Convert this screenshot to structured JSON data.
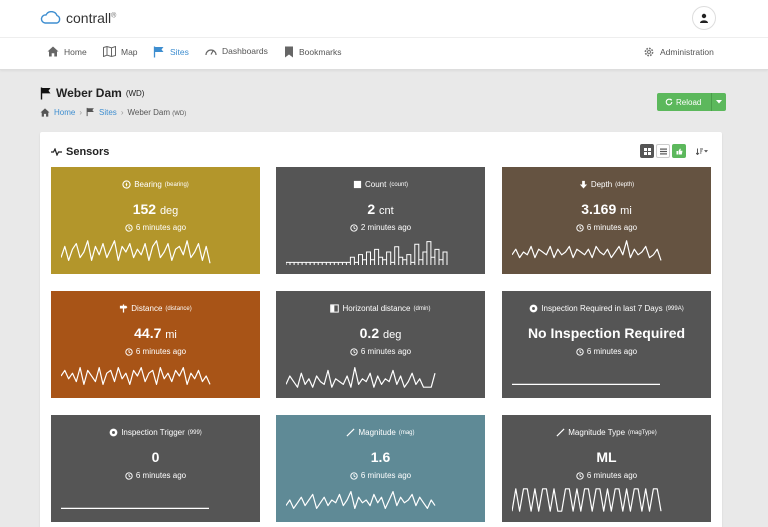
{
  "app": {
    "brand": "contrall",
    "brand_mark": "®"
  },
  "nav": {
    "items": [
      {
        "label": "Home",
        "icon": "home-icon"
      },
      {
        "label": "Map",
        "icon": "map-icon"
      },
      {
        "label": "Sites",
        "icon": "flag-icon",
        "active": true
      },
      {
        "label": "Dashboards",
        "icon": "gauge-icon"
      },
      {
        "label": "Bookmarks",
        "icon": "bookmark-icon"
      }
    ],
    "admin_label": "Administration"
  },
  "page": {
    "title": "Weber Dam",
    "code": "(WD)",
    "breadcrumb": {
      "home": "Home",
      "sites": "Sites",
      "current": "Weber Dam",
      "current_code": "(WD)"
    },
    "reload_label": "Reload"
  },
  "panel": {
    "title": "Sensors"
  },
  "cards": [
    {
      "title": "Bearing",
      "code": "(bearing)",
      "value": "152",
      "unit": "deg",
      "time": "6 minutes ago",
      "color": "#b3962b",
      "icon": "compass-icon",
      "spark": [
        0.3,
        0.7,
        0.2,
        0.6,
        0.8,
        0.3,
        0.5,
        0.9,
        0.2,
        0.7,
        0.4,
        0.8,
        0.3,
        0.6,
        0.9,
        0.2,
        0.7,
        0.5,
        0.8,
        0.3,
        0.6,
        0.4,
        0.8,
        0.2,
        0.7,
        0.9,
        0.3,
        0.5,
        0.8,
        0.2,
        0.6,
        0.7,
        0.4,
        0.9,
        0.3,
        0.5,
        0.8,
        0.2,
        0.7,
        0.1
      ]
    },
    {
      "title": "Count",
      "code": "(count)",
      "value": "2",
      "unit": "cnt",
      "time": "2 minutes ago",
      "color": "#555555",
      "icon": "square-icon",
      "spark": [
        0.1,
        0.1,
        0.1,
        0.1,
        0.1,
        0.1,
        0.1,
        0.1,
        0.1,
        0.1,
        0.1,
        0.1,
        0.1,
        0.1,
        0.1,
        0.1,
        0.3,
        0.1,
        0.4,
        0.2,
        0.5,
        0.2,
        0.6,
        0.3,
        0.2,
        0.5,
        0.1,
        0.7,
        0.3,
        0.2,
        0.4,
        0.1,
        0.8,
        0.2,
        0.5,
        0.9,
        0.3,
        0.6,
        0.2,
        0.5
      ]
    },
    {
      "title": "Depth",
      "code": "(depth)",
      "value": "3.169",
      "unit": "mi",
      "time": "6 minutes ago",
      "color": "#655341",
      "icon": "arrow-down-icon",
      "spark": [
        0.4,
        0.6,
        0.3,
        0.5,
        0.4,
        0.7,
        0.3,
        0.6,
        0.5,
        0.4,
        0.7,
        0.3,
        0.6,
        0.4,
        0.5,
        0.7,
        0.3,
        0.6,
        0.5,
        0.4,
        0.6,
        0.3,
        0.7,
        0.5,
        0.4,
        0.6,
        0.3,
        0.5,
        0.7,
        0.4,
        0.9,
        0.3,
        0.6,
        0.4,
        0.5,
        0.7,
        0.3,
        0.4,
        0.6,
        0.2
      ]
    },
    {
      "title": "Distance",
      "code": "(distance)",
      "value": "44.7",
      "unit": "mi",
      "time": "6 minutes ago",
      "color": "#a85417",
      "icon": "signpost-icon",
      "spark": [
        0.5,
        0.7,
        0.4,
        0.6,
        0.3,
        0.8,
        0.2,
        0.7,
        0.5,
        0.3,
        0.8,
        0.2,
        0.6,
        0.7,
        0.3,
        0.8,
        0.4,
        0.6,
        0.2,
        0.7,
        0.5,
        0.8,
        0.3,
        0.6,
        0.7,
        0.2,
        0.8,
        0.4,
        0.6,
        0.3,
        0.7,
        0.5,
        0.8,
        0.2,
        0.6,
        0.4,
        0.7,
        0.3,
        0.5,
        0.2
      ]
    },
    {
      "title": "Horizontal distance",
      "code": "(dmin)",
      "value": "0.2",
      "unit": "deg",
      "time": "6 minutes ago",
      "color": "#555555",
      "icon": "columns-icon",
      "spark": [
        0.2,
        0.5,
        0.3,
        0.1,
        0.6,
        0.2,
        0.4,
        0.1,
        0.5,
        0.3,
        0.2,
        0.7,
        0.1,
        0.4,
        0.3,
        0.2,
        0.5,
        0.1,
        0.8,
        0.2,
        0.4,
        0.3,
        0.6,
        0.1,
        0.5,
        0.2,
        0.4,
        0.3,
        0.7,
        0.2,
        0.5,
        0.1,
        0.3,
        0.6,
        0.2,
        0.4,
        0.1,
        0.1,
        0.1,
        0.6
      ]
    },
    {
      "title": "Inspection Required in last 7 Days",
      "code": "(999A)",
      "value": "No Inspection Required",
      "unit": "",
      "time": "6 minutes ago",
      "color": "#555555",
      "icon": "dot-circle-icon",
      "spark": [
        0.2,
        0.2,
        0.2,
        0.2,
        0.2,
        0.2,
        0.2,
        0.2,
        0.2,
        0.2,
        0.2,
        0.2,
        0.2,
        0.2,
        0.2,
        0.2,
        0.2,
        0.2,
        0.2,
        0.2
      ]
    },
    {
      "title": "Inspection Trigger",
      "code": "(999)",
      "value": "0",
      "unit": "",
      "time": "6 minutes ago",
      "color": "#555555",
      "icon": "dot-circle-icon",
      "spark": [
        0.2,
        0.2,
        0.2,
        0.2,
        0.2,
        0.2,
        0.2,
        0.2,
        0.2,
        0.2,
        0.2,
        0.2,
        0.2,
        0.2,
        0.2,
        0.2,
        0.2,
        0.2,
        0.2,
        0.2
      ]
    },
    {
      "title": "Magnitude",
      "code": "(mag)",
      "value": "1.6",
      "unit": "",
      "time": "6 minutes ago",
      "color": "#5f8a96",
      "icon": "slash-icon",
      "spark": [
        0.3,
        0.5,
        0.2,
        0.4,
        0.6,
        0.3,
        0.5,
        0.7,
        0.2,
        0.4,
        0.6,
        0.3,
        0.5,
        0.4,
        0.7,
        0.3,
        0.5,
        0.8,
        0.2,
        0.6,
        0.4,
        0.5,
        0.3,
        0.7,
        0.4,
        0.6,
        0.2,
        0.5,
        0.8,
        0.3,
        0.6,
        0.4,
        0.5,
        0.7,
        0.3,
        0.6,
        0.4,
        0.2,
        0.5,
        0.3
      ]
    },
    {
      "title": "Magnitude Type",
      "code": "(magType)",
      "value": "ML",
      "unit": "",
      "time": "6 minutes ago",
      "color": "#555555",
      "icon": "slash-icon",
      "spark": [
        0.1,
        0.9,
        0.1,
        0.9,
        0.9,
        0.1,
        0.9,
        0.1,
        0.9,
        0.9,
        0.1,
        0.9,
        0.1,
        0.1,
        0.9,
        0.9,
        0.1,
        0.9,
        0.1,
        0.9,
        0.9,
        0.1,
        0.9,
        0.9,
        0.1,
        0.9,
        0.1,
        0.9,
        0.9,
        0.1,
        0.9,
        0.1,
        0.9,
        0.9,
        0.1,
        0.9,
        0.1,
        0.9,
        0.9,
        0.1
      ]
    }
  ]
}
